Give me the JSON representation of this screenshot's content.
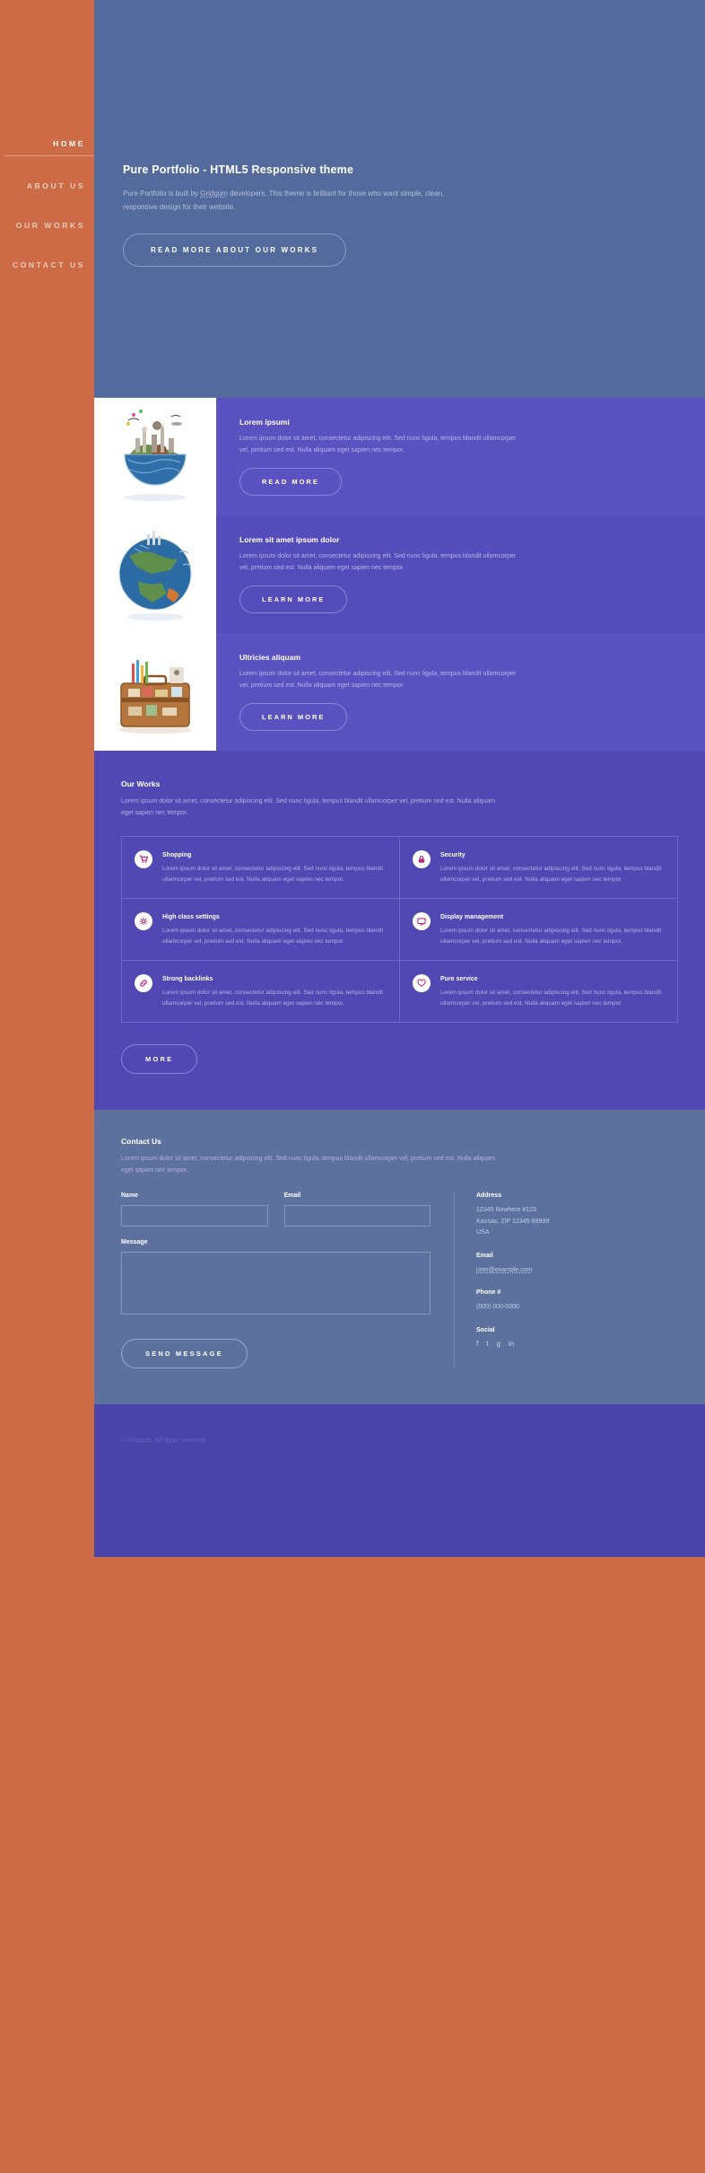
{
  "sidebar": {
    "items": [
      {
        "label": "HOME",
        "active": true
      },
      {
        "label": "ABOUT US",
        "active": false
      },
      {
        "label": "OUR WORKS",
        "active": false
      },
      {
        "label": "CONTACT US",
        "active": false
      }
    ]
  },
  "hero": {
    "title": "Pure Portfolio - HTML5 Responsive theme",
    "text_before": "Pure Portfolio is built by ",
    "link": "Gridgum",
    "text_after": " developers. This theme is brilliant for those who want simple, clean, responsive design for their website.",
    "cta": "READ MORE ABOUT OUR WORKS"
  },
  "features": [
    {
      "title": "Lorem ipsumi",
      "text": "Lorem ipsum dolor sit amet, consectetur adipiscing elit. Sed nunc ligula, tempus blandit ullamcorper vel, pretium sed est. Nulla aliquam eget sapien nec tempor.",
      "button": "READ MORE",
      "image": "globe-city-bowl"
    },
    {
      "title": "Lorem sit amet ipsum dolor",
      "text": "Lorem ipsum dolor sit amet, consectetur adipiscing elit. Sed nunc ligula, tempus blandit ullamcorper vel, pretium sed est. Nulla aliquam eget sapien nec tempor.",
      "button": "LEARN MORE",
      "image": "globe-planet"
    },
    {
      "title": "Ultricies aliquam",
      "text": "Lorem ipsum dolor sit amet, consectetur adipiscing elit. Sed nunc ligula, tempus blandit ullamcorper vel, pretium sed est. Nulla aliquam eget sapien nec tempor.",
      "button": "LEARN MORE",
      "image": "travel-suitcase"
    }
  ],
  "works": {
    "title": "Our Works",
    "desc": "Lorem ipsum dolor sit amet, consectetur adipiscing elit. Sed nunc ligula, tempus blandit ullamcorper vel, pretium sed est. Nulla aliquam eget sapien nec tempor.",
    "body": "Lorem ipsum dolor sit amet, consectetur adipiscing elit. Sed nunc ligula, tempus blandit ullamcorper vel, pretium sed est. Nulla aliquam eget sapien nec tempor.",
    "more": "MORE",
    "items": [
      {
        "title": "Shopping",
        "icon": "cart-icon"
      },
      {
        "title": "Security",
        "icon": "lock-icon"
      },
      {
        "title": "High class settings",
        "icon": "gear-icon"
      },
      {
        "title": "Display management",
        "icon": "monitor-icon"
      },
      {
        "title": "Strong backlinks",
        "icon": "link-icon"
      },
      {
        "title": "Pure service",
        "icon": "heart-icon"
      }
    ]
  },
  "contact": {
    "title": "Contact Us",
    "desc": "Lorem ipsum dolor sit amet, consectetur adipiscing elit. Sed nunc ligula, tempus blandit ullamcorper vel, pretium sed est. Nulla aliquam eget sapien nec tempor.",
    "name_label": "Name",
    "email_label": "Email",
    "message_label": "Message",
    "name_value": "",
    "email_value": "",
    "message_value": "",
    "submit": "SEND MESSAGE",
    "address_label": "Address",
    "address_line1": "12345 Nowhere #123",
    "address_line2": "Kansas, ZIP 12345-99999",
    "address_line3": "USA",
    "email_heading": "Email",
    "email_value_text": "user@example.com",
    "phone_label": "Phone #",
    "phone_value": "(000) 000-0000",
    "social_label": "Social",
    "social": [
      "f",
      "t",
      "g",
      "in"
    ]
  },
  "footer": {
    "copyright": "© Gridgum. All rights reserved."
  },
  "colors": {
    "sidebar": "#cc6b45",
    "hero": "#536a9c",
    "feature_a": "#5a52c0",
    "feature_b": "#544cba",
    "works": "#5148b4",
    "contact": "#5d719f",
    "footer": "#4a43a8",
    "icon_accent": "#c2277a"
  }
}
